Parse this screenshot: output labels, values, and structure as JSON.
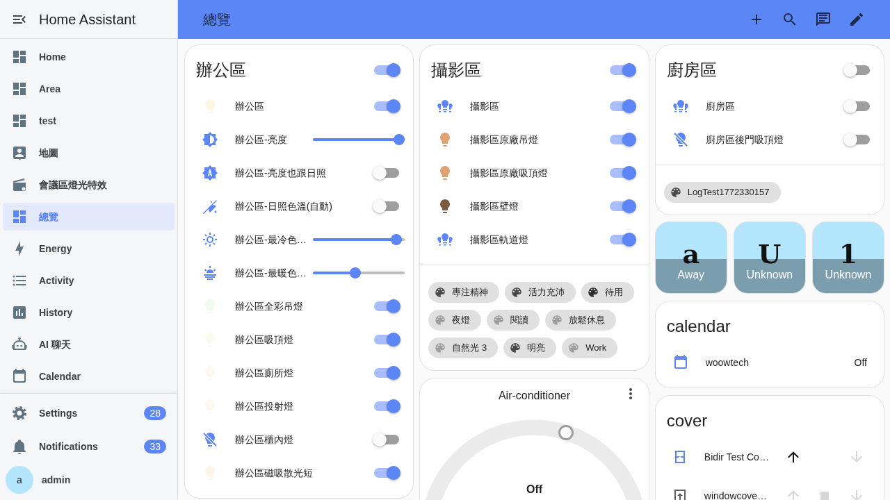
{
  "sidebar": {
    "title": "Home Assistant",
    "items": [
      {
        "label": "Home",
        "selected": false
      },
      {
        "label": "Area",
        "selected": false
      },
      {
        "label": "test",
        "selected": false
      },
      {
        "label": "地圖",
        "selected": false
      },
      {
        "label": "會議區燈光特效",
        "selected": false
      },
      {
        "label": "總覽",
        "selected": true
      },
      {
        "label": "Energy",
        "selected": false
      },
      {
        "label": "Activity",
        "selected": false
      },
      {
        "label": "History",
        "selected": false
      },
      {
        "label": "AI 聊天",
        "selected": false
      },
      {
        "label": "Calendar",
        "selected": false
      }
    ],
    "bottom": [
      {
        "label": "Settings",
        "badge": "28"
      },
      {
        "label": "Notifications",
        "badge": "33"
      }
    ],
    "user": {
      "initial": "a",
      "name": "admin"
    }
  },
  "header": {
    "title": "總覽"
  },
  "office": {
    "title": "辦公區",
    "on": true,
    "rows": [
      {
        "kind": "toggle",
        "label": "辦公區",
        "color": "#fdf6e3",
        "on": true
      },
      {
        "kind": "slider",
        "label": "辦公區-亮度",
        "color": "#5c85f5",
        "level": 1
      },
      {
        "kind": "toggle",
        "label": "辦公區-亮度也跟日照",
        "color": "#5c85f5",
        "on": false
      },
      {
        "kind": "toggle",
        "label": "辦公區-日照色溫(自動)",
        "color": "#5c85f5",
        "on": false
      },
      {
        "kind": "slider",
        "label": "辦公區-最冷色…",
        "color": "#5c85f5",
        "level": 0.96
      },
      {
        "kind": "slider",
        "label": "辦公區-最暖色…",
        "color": "#5c85f5",
        "level": 0.45
      },
      {
        "kind": "toggle",
        "label": "辦公區全彩吊燈",
        "color": "#eefbee",
        "on": true
      },
      {
        "kind": "toggle",
        "label": "辦公區吸頂燈",
        "color": "#fbfbef",
        "on": true
      },
      {
        "kind": "toggle",
        "label": "辦公區廁所燈",
        "color": "#fcfaf0",
        "on": true
      },
      {
        "kind": "toggle",
        "label": "辦公區投射燈",
        "color": "#fcfaf0",
        "on": true
      },
      {
        "kind": "toggle",
        "label": "辦公區櫃內燈",
        "color": "#5c85f5",
        "on": false
      },
      {
        "kind": "toggle",
        "label": "辦公區磁吸散光短",
        "color": "#fdf5e8",
        "on": true
      }
    ]
  },
  "studio": {
    "title": "攝影區",
    "on": true,
    "rows": [
      {
        "label": "攝影區",
        "color": "#5c85f5",
        "on": true
      },
      {
        "label": "攝影區原廠吊燈",
        "color": "#e0a272",
        "on": true
      },
      {
        "label": "攝影區原廠吸頂燈",
        "color": "#e0a272",
        "on": true
      },
      {
        "label": "攝影區壁燈",
        "color": "#7b5a3e",
        "on": true
      },
      {
        "label": "攝影區軌道燈",
        "color": "#5c85f5",
        "on": true
      }
    ],
    "scenes": [
      {
        "label": "專注精神",
        "color": "#4a4a4a"
      },
      {
        "label": "活力充沛",
        "color": "#4a4a4a"
      },
      {
        "label": "待用",
        "color": "#2e2e2e"
      },
      {
        "label": "夜燈",
        "color": "#9e9e9e"
      },
      {
        "label": "閱讀",
        "color": "#9e9e9e"
      },
      {
        "label": "放鬆休息",
        "color": "#9e9e9e"
      },
      {
        "label": "自然光 3",
        "color": "#9e9e9e"
      },
      {
        "label": "明亮",
        "color": "#4a4a4a"
      },
      {
        "label": "Work",
        "color": "#9e9e9e"
      }
    ]
  },
  "thermostat": {
    "title": "Air-conditioner",
    "state": "Off"
  },
  "kitchen": {
    "title": "廚房區",
    "on": false,
    "rows": [
      {
        "label": "廚房區",
        "color": "#5c85f5",
        "on": false
      },
      {
        "label": "廚房區後門吸頂燈",
        "color": "#5c85f5",
        "on": false
      }
    ],
    "scenes": [
      {
        "label": "LogTest1772330157",
        "color": "#4a4a4a"
      }
    ]
  },
  "tiles": [
    {
      "glyph": "a",
      "state": "Away"
    },
    {
      "glyph": "U",
      "state": "Unknown"
    },
    {
      "glyph": "1",
      "state": "Unknown"
    }
  ],
  "calendar": {
    "title": "calendar",
    "rows": [
      {
        "label": "woowtech",
        "state": "Off"
      }
    ]
  },
  "cover": {
    "title": "cover",
    "rows": [
      {
        "label": "Bidir Test Co…",
        "up_enabled": true,
        "stop": false,
        "down_enabled": false
      },
      {
        "label": "windowcove…",
        "up_enabled": false,
        "stop": true,
        "down_enabled": false
      }
    ]
  }
}
